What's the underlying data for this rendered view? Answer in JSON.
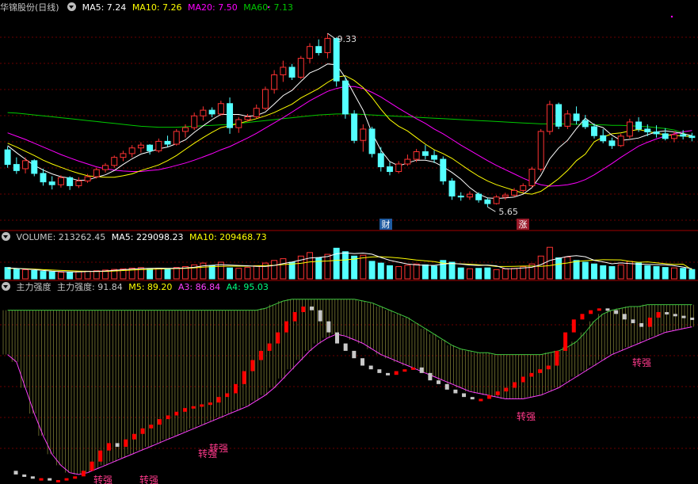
{
  "colors": {
    "bg": "#000000",
    "up": "#ff3232",
    "down": "#54ffff",
    "grid": "#6a0000",
    "sep": "#a00000",
    "ma5": "#ffffff",
    "ma10": "#ffff00",
    "ma20": "#ff00ff",
    "ma60": "#00c800",
    "strength_up": "#ff0000",
    "strength_down": "#c8c8c8",
    "a3": "#ff40ff",
    "a4": "#c8c800",
    "label": "#ff3a8c"
  },
  "icons": {
    "panel_toggle": "chevron-down-icon"
  },
  "price_panel": {
    "title": "华锦股份(日线)",
    "ma5": "MA5: 7.24",
    "ma10": "MA10: 7.26",
    "ma20": "MA20: 7.50",
    "ma60": "MA60: 7.13",
    "high_label": "9.33",
    "low_label": "5.65",
    "badge_cai": "财",
    "badge_zhang": "涨"
  },
  "volume_panel": {
    "label": "VOLUME: 213262.45",
    "ma5": "MA5: 229098.23",
    "ma10": "MA10: 209468.73"
  },
  "strength_panel": {
    "name": "主力强度",
    "value": "主力强度: 91.84",
    "m5": "M5: 89.20",
    "a3": "A3: 86.84",
    "a4": "A4: 95.03",
    "turn_label": "转强"
  },
  "chart_data": {
    "type": "candlestick",
    "title": "华锦股份(日线)",
    "price_ylim": [
      5.2,
      9.7
    ],
    "candles_ohlc": [
      [
        6.86,
        6.93,
        6.48,
        6.55
      ],
      [
        6.55,
        6.7,
        6.35,
        6.42
      ],
      [
        6.46,
        6.7,
        6.36,
        6.63
      ],
      [
        6.63,
        6.66,
        6.3,
        6.36
      ],
      [
        6.36,
        6.46,
        6.1,
        6.18
      ],
      [
        6.18,
        6.3,
        6.02,
        6.12
      ],
      [
        6.12,
        6.32,
        6.06,
        6.27
      ],
      [
        6.27,
        6.3,
        6.01,
        6.1
      ],
      [
        6.1,
        6.28,
        6.05,
        6.2
      ],
      [
        6.2,
        6.35,
        6.16,
        6.29
      ],
      [
        6.29,
        6.48,
        6.25,
        6.44
      ],
      [
        6.44,
        6.58,
        6.38,
        6.53
      ],
      [
        6.53,
        6.74,
        6.48,
        6.7
      ],
      [
        6.7,
        6.84,
        6.62,
        6.78
      ],
      [
        6.78,
        6.96,
        6.7,
        6.9
      ],
      [
        6.9,
        7.02,
        6.8,
        6.96
      ],
      [
        6.96,
        6.98,
        6.76,
        6.84
      ],
      [
        6.84,
        7.1,
        6.8,
        7.04
      ],
      [
        7.04,
        7.16,
        6.92,
        6.98
      ],
      [
        6.98,
        7.3,
        6.95,
        7.25
      ],
      [
        7.25,
        7.4,
        7.12,
        7.33
      ],
      [
        7.33,
        7.65,
        7.28,
        7.58
      ],
      [
        7.58,
        7.78,
        7.48,
        7.7
      ],
      [
        7.7,
        7.76,
        7.55,
        7.62
      ],
      [
        7.62,
        7.9,
        7.58,
        7.84
      ],
      [
        7.84,
        7.97,
        7.2,
        7.33
      ],
      [
        7.33,
        7.55,
        7.22,
        7.5
      ],
      [
        7.5,
        7.62,
        7.46,
        7.56
      ],
      [
        7.56,
        7.82,
        7.52,
        7.74
      ],
      [
        7.74,
        8.2,
        7.7,
        8.14
      ],
      [
        8.14,
        8.55,
        8.05,
        8.45
      ],
      [
        8.45,
        8.75,
        8.3,
        8.61
      ],
      [
        8.61,
        8.68,
        8.34,
        8.4
      ],
      [
        8.4,
        8.85,
        8.36,
        8.8
      ],
      [
        8.8,
        9.12,
        8.7,
        9.05
      ],
      [
        9.05,
        9.2,
        8.86,
        8.92
      ],
      [
        8.92,
        9.33,
        8.8,
        9.22
      ],
      [
        9.22,
        9.25,
        8.2,
        8.32
      ],
      [
        8.32,
        8.4,
        7.52,
        7.62
      ],
      [
        7.62,
        7.7,
        7.0,
        7.06
      ],
      [
        7.06,
        7.4,
        6.82,
        7.3
      ],
      [
        7.3,
        7.35,
        6.7,
        6.78
      ],
      [
        6.78,
        6.92,
        6.4,
        6.5
      ],
      [
        6.5,
        6.6,
        6.32,
        6.4
      ],
      [
        6.4,
        6.62,
        6.36,
        6.56
      ],
      [
        6.56,
        6.76,
        6.52,
        6.66
      ],
      [
        6.66,
        6.88,
        6.6,
        6.82
      ],
      [
        6.82,
        6.96,
        6.66,
        6.74
      ],
      [
        6.74,
        6.85,
        6.58,
        6.66
      ],
      [
        6.66,
        6.72,
        6.12,
        6.2
      ],
      [
        6.2,
        6.26,
        5.8,
        5.88
      ],
      [
        5.88,
        5.96,
        5.78,
        5.86
      ],
      [
        5.86,
        5.98,
        5.8,
        5.92
      ],
      [
        5.92,
        5.96,
        5.74,
        5.8
      ],
      [
        5.8,
        5.84,
        5.65,
        5.72
      ],
      [
        5.72,
        5.9,
        5.7,
        5.86
      ],
      [
        5.86,
        5.95,
        5.8,
        5.9
      ],
      [
        5.9,
        6.05,
        5.86,
        6.0
      ],
      [
        6.0,
        6.15,
        5.95,
        6.1
      ],
      [
        6.1,
        6.5,
        6.06,
        6.45
      ],
      [
        6.45,
        7.3,
        6.4,
        7.25
      ],
      [
        7.25,
        7.9,
        7.18,
        7.82
      ],
      [
        7.82,
        7.86,
        7.3,
        7.36
      ],
      [
        7.36,
        7.7,
        7.3,
        7.62
      ],
      [
        7.62,
        7.78,
        7.4,
        7.48
      ],
      [
        7.48,
        7.6,
        7.3,
        7.35
      ],
      [
        7.35,
        7.42,
        7.1,
        7.16
      ],
      [
        7.16,
        7.3,
        7.0,
        7.05
      ],
      [
        7.05,
        7.12,
        6.88,
        6.95
      ],
      [
        6.95,
        7.2,
        6.92,
        7.15
      ],
      [
        7.15,
        7.52,
        7.1,
        7.45
      ],
      [
        7.45,
        7.55,
        7.24,
        7.3
      ],
      [
        7.3,
        7.4,
        7.15,
        7.24
      ],
      [
        7.24,
        7.38,
        7.12,
        7.2
      ],
      [
        7.2,
        7.32,
        7.06,
        7.1
      ],
      [
        7.1,
        7.25,
        7.02,
        7.18
      ],
      [
        7.18,
        7.28,
        7.08,
        7.15
      ],
      [
        7.15,
        7.22,
        7.04,
        7.12
      ]
    ],
    "ma5": [
      6.95,
      6.8,
      6.66,
      6.53,
      6.43,
      6.35,
      6.29,
      6.26,
      6.21,
      6.22,
      6.28,
      6.33,
      6.42,
      6.55,
      6.67,
      6.77,
      6.82,
      6.88,
      6.92,
      6.99,
      7.07,
      7.23,
      7.37,
      7.5,
      7.61,
      7.61,
      7.61,
      7.57,
      7.59,
      7.66,
      7.83,
      8.01,
      8.12,
      8.31,
      8.49,
      8.57,
      8.68,
      8.66,
      8.39,
      8.04,
      7.7,
      7.22,
      6.85,
      6.61,
      6.52,
      6.58,
      6.64,
      6.64,
      6.6,
      6.5,
      6.38,
      6.24,
      6.06,
      5.92,
      5.84,
      5.83,
      5.84,
      5.86,
      5.92,
      6.06,
      6.32,
      6.67,
      6.9,
      7.06,
      7.31,
      7.53,
      7.39,
      7.33,
      7.17,
      7.06,
      7.08,
      7.11,
      7.18,
      7.24,
      7.26,
      7.24,
      7.2,
      7.16
    ],
    "ma10": [
      7.0,
      6.92,
      6.83,
      6.74,
      6.64,
      6.56,
      6.49,
      6.42,
      6.36,
      6.31,
      6.29,
      6.28,
      6.28,
      6.31,
      6.35,
      6.42,
      6.48,
      6.54,
      6.63,
      6.74,
      6.87,
      7.0,
      7.12,
      7.23,
      7.33,
      7.37,
      7.42,
      7.47,
      7.52,
      7.58,
      7.65,
      7.74,
      7.83,
      7.96,
      8.06,
      8.16,
      8.29,
      8.4,
      8.43,
      8.33,
      8.18,
      7.97,
      7.72,
      7.5,
      7.36,
      7.26,
      7.12,
      6.98,
      6.86,
      6.78,
      6.68,
      6.55,
      6.42,
      6.3,
      6.2,
      6.12,
      6.06,
      6.0,
      5.94,
      5.92,
      5.98,
      6.11,
      6.25,
      6.42,
      6.63,
      6.77,
      7.03,
      7.13,
      7.2,
      7.22,
      7.26,
      7.29,
      7.25,
      7.21,
      7.18,
      7.17,
      7.15,
      7.14
    ],
    "ma20": [
      7.22,
      7.15,
      7.08,
      7.0,
      6.92,
      6.84,
      6.76,
      6.69,
      6.62,
      6.56,
      6.5,
      6.46,
      6.43,
      6.41,
      6.4,
      6.4,
      6.42,
      6.44,
      6.48,
      6.53,
      6.58,
      6.64,
      6.71,
      6.78,
      6.86,
      6.93,
      7.02,
      7.11,
      7.21,
      7.32,
      7.43,
      7.54,
      7.66,
      7.78,
      7.9,
      8.0,
      8.1,
      8.16,
      8.2,
      8.2,
      8.16,
      8.08,
      7.98,
      7.86,
      7.74,
      7.63,
      7.52,
      7.42,
      7.3,
      7.2,
      7.08,
      6.96,
      6.85,
      6.74,
      6.63,
      6.53,
      6.44,
      6.35,
      6.26,
      6.18,
      6.12,
      6.09,
      6.1,
      6.12,
      6.16,
      6.23,
      6.33,
      6.45,
      6.57,
      6.7,
      6.82,
      6.94,
      7.02,
      7.09,
      7.15,
      7.2,
      7.24,
      7.27
    ],
    "ma60": [
      7.65,
      7.64,
      7.62,
      7.6,
      7.58,
      7.56,
      7.54,
      7.52,
      7.5,
      7.48,
      7.46,
      7.44,
      7.42,
      7.4,
      7.38,
      7.36,
      7.35,
      7.34,
      7.34,
      7.34,
      7.35,
      7.36,
      7.37,
      7.38,
      7.39,
      7.4,
      7.42,
      7.44,
      7.46,
      7.48,
      7.5,
      7.52,
      7.54,
      7.56,
      7.58,
      7.6,
      7.61,
      7.62,
      7.62,
      7.62,
      7.61,
      7.6,
      7.59,
      7.58,
      7.57,
      7.56,
      7.55,
      7.54,
      7.53,
      7.52,
      7.51,
      7.5,
      7.49,
      7.48,
      7.47,
      7.46,
      7.45,
      7.44,
      7.43,
      7.42,
      7.41,
      7.41,
      7.41,
      7.41,
      7.4,
      7.4,
      7.39,
      7.39,
      7.38,
      7.38,
      7.37,
      7.36,
      7.35,
      7.33,
      7.31,
      7.28,
      7.22,
      7.13
    ],
    "volume": [
      260,
      230,
      210,
      190,
      170,
      160,
      150,
      155,
      165,
      175,
      185,
      200,
      215,
      230,
      245,
      255,
      235,
      240,
      225,
      260,
      280,
      320,
      360,
      300,
      380,
      250,
      240,
      260,
      300,
      360,
      420,
      460,
      380,
      520,
      600,
      480,
      560,
      700,
      620,
      520,
      540,
      400,
      360,
      300,
      280,
      310,
      340,
      320,
      290,
      420,
      380,
      250,
      230,
      240,
      250,
      210,
      230,
      240,
      280,
      340,
      520,
      720,
      480,
      500,
      420,
      380,
      340,
      300,
      280,
      320,
      400,
      360,
      300,
      280,
      260,
      250,
      240,
      213
    ],
    "vol_ma5": [
      250,
      240,
      225,
      210,
      192,
      176,
      165,
      158,
      160,
      166,
      172,
      180,
      195,
      208,
      222,
      235,
      240,
      244,
      240,
      243,
      248,
      265,
      297,
      309,
      324,
      314,
      306,
      298,
      286,
      282,
      306,
      348,
      384,
      428,
      476,
      488,
      508,
      572,
      592,
      578,
      588,
      562,
      489,
      424,
      380,
      338,
      318,
      310,
      308,
      336,
      352,
      336,
      314,
      306,
      314,
      296,
      232,
      234,
      250,
      264,
      324,
      420,
      468,
      512,
      528,
      504,
      424,
      388,
      344,
      364,
      350,
      336,
      332,
      324,
      320,
      300,
      270,
      229
    ],
    "vol_ma10": [
      240,
      235,
      230,
      220,
      210,
      200,
      192,
      185,
      178,
      172,
      168,
      170,
      180,
      190,
      200,
      210,
      218,
      225,
      230,
      235,
      240,
      252,
      268,
      279,
      286,
      289,
      290,
      290,
      297,
      303,
      310,
      326,
      339,
      355,
      387,
      400,
      407,
      424,
      432,
      452,
      480,
      500,
      505,
      492,
      478,
      455,
      430,
      412,
      395,
      358,
      350,
      342,
      335,
      322,
      308,
      282,
      282,
      286,
      292,
      292,
      284,
      302,
      336,
      362,
      398,
      415,
      427,
      436,
      434,
      432,
      398,
      379,
      388,
      368,
      346,
      332,
      335,
      209
    ]
  },
  "strength_data": {
    "ylim": [
      0,
      100
    ],
    "values": [
      5,
      3,
      2,
      1,
      1,
      0,
      0,
      1,
      2,
      5,
      10,
      16,
      20,
      18,
      22,
      25,
      28,
      30,
      33,
      35,
      37,
      39,
      40,
      41,
      42,
      45,
      47,
      52,
      59,
      65,
      70,
      74,
      80,
      86,
      91,
      94,
      92,
      86,
      80,
      74,
      70,
      66,
      62,
      60,
      58,
      57,
      59,
      60,
      61,
      58,
      54,
      52,
      49,
      47,
      45,
      44,
      44,
      46,
      48,
      50,
      53,
      56,
      58,
      60,
      62,
      70,
      80,
      87,
      90,
      92,
      93,
      92,
      90,
      87,
      85,
      83,
      88,
      91,
      90,
      89,
      88,
      87
    ],
    "cloud_a3": [
      68,
      64,
      50,
      36,
      24,
      14,
      8,
      4,
      3,
      4,
      6,
      8,
      10,
      12,
      14,
      16,
      18,
      20,
      22,
      24,
      26,
      28,
      30,
      32,
      34,
      36,
      38,
      40,
      43,
      46,
      50,
      55,
      60,
      65,
      70,
      74,
      77,
      79,
      78,
      76,
      74,
      71,
      68,
      66,
      64,
      62,
      60,
      58,
      56,
      54,
      52,
      50,
      48,
      47,
      46,
      45,
      44,
      44,
      44,
      45,
      46,
      48,
      50,
      53,
      56,
      59,
      62,
      65,
      68,
      70,
      72,
      74,
      76,
      78,
      80,
      81,
      82,
      83
    ],
    "cloud_a4": [
      92,
      92,
      92,
      92,
      92,
      92,
      92,
      92,
      92,
      92,
      92,
      92,
      92,
      92,
      92,
      92,
      92,
      92,
      92,
      92,
      92,
      92,
      92,
      92,
      92,
      92,
      92,
      92,
      92,
      93,
      95,
      97,
      98,
      98,
      98,
      98,
      98,
      98,
      98,
      98,
      97,
      96,
      94,
      92,
      90,
      88,
      85,
      82,
      79,
      76,
      73,
      71,
      70,
      69,
      69,
      68,
      68,
      68,
      68,
      68,
      68,
      69,
      70,
      72,
      75,
      80,
      86,
      90,
      92,
      93,
      94,
      94,
      95,
      95,
      95,
      95,
      95,
      95
    ],
    "turn_label_at": [
      16,
      27,
      28,
      64,
      71
    ]
  }
}
